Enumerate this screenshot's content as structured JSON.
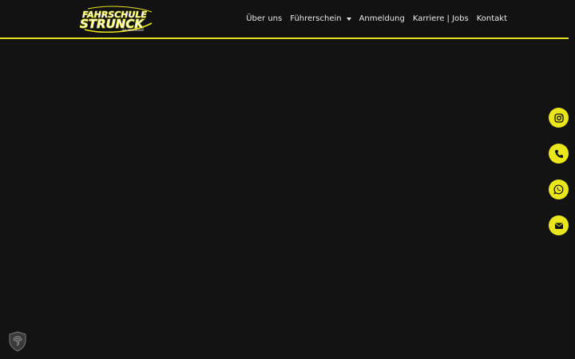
{
  "brand": {
    "logo_line1": "FAHRSCHULE",
    "logo_line2": "STRUNCK",
    "logo_tagline": "AM TEGERNSEE",
    "accent_color": "#e9e61c"
  },
  "nav": {
    "items": [
      {
        "label": "Über uns"
      },
      {
        "label": "Führerschein",
        "has_dropdown": true
      },
      {
        "label": "Anmeldung"
      },
      {
        "label": "Karriere | Jobs"
      },
      {
        "label": "Kontakt"
      }
    ]
  },
  "social": [
    {
      "icon": "instagram-icon"
    },
    {
      "icon": "phone-icon"
    },
    {
      "icon": "whatsapp-icon"
    },
    {
      "icon": "mail-icon"
    }
  ],
  "badge": {
    "icon": "fingerprint-shield-icon"
  }
}
